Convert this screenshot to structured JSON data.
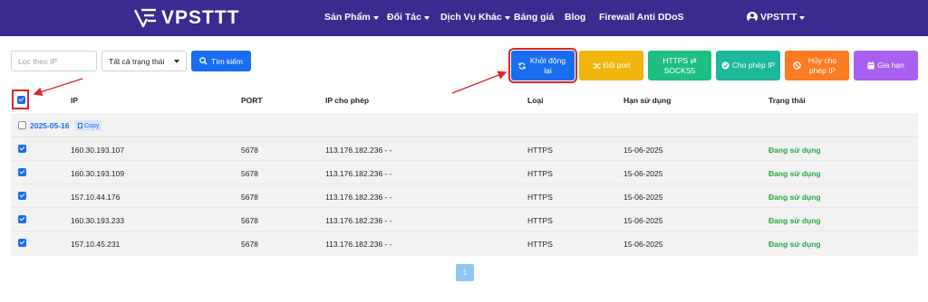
{
  "nav": {
    "logo_text": "VPSTTT",
    "items": [
      {
        "label": "Sản Phẩm",
        "has_caret": true
      },
      {
        "label": "Đối Tác",
        "has_caret": true
      },
      {
        "label": "Dịch Vụ Khác",
        "has_caret": true
      },
      {
        "label": "Bảng giá",
        "has_caret": false
      },
      {
        "label": "Blog",
        "has_caret": false
      },
      {
        "label": "Firewall Anti DDoS",
        "has_caret": false
      }
    ],
    "user": {
      "label": "VPSTTT",
      "icon": "user-circle-icon"
    }
  },
  "filters": {
    "ip_placeholder": "Lọc theo IP",
    "status_selected": "Tất cả trạng thái",
    "search_label": "Tìm kiếm"
  },
  "actions": {
    "restart": "Khởi động lại",
    "change_port": "Đổi port",
    "https_socks": "HTTPS ⇄ SOCKS5",
    "allow_ip": "Cho phép IP",
    "cancel_allow_ip": "Hủy cho phép IP",
    "renew": "Gia hạn"
  },
  "table": {
    "headers": [
      "IP",
      "PORT",
      "IP cho phép",
      "Loại",
      "Hạn sử dụng",
      "Trạng thái"
    ],
    "group": {
      "date": "2025-05-16",
      "copy_label": "Copy"
    },
    "rows": [
      {
        "ip": "160.30.193.107",
        "port": "5678",
        "allowed_ip": "113.176.182.236 - -",
        "type": "HTTPS",
        "expiry": "15-06-2025",
        "status": "Đang sử dụng"
      },
      {
        "ip": "160.30.193.109",
        "port": "5678",
        "allowed_ip": "113.176.182.236 - -",
        "type": "HTTPS",
        "expiry": "15-06-2025",
        "status": "Đang sử dụng"
      },
      {
        "ip": "157.10.44.176",
        "port": "5678",
        "allowed_ip": "113.176.182.236 - -",
        "type": "HTTPS",
        "expiry": "15-06-2025",
        "status": "Đang sử dụng"
      },
      {
        "ip": "160.30.193.233",
        "port": "5678",
        "allowed_ip": "113.176.182.236 - -",
        "type": "HTTPS",
        "expiry": "15-06-2025",
        "status": "Đang sử dụng"
      },
      {
        "ip": "157.10.45.231",
        "port": "5678",
        "allowed_ip": "113.176.182.236 - -",
        "type": "HTTPS",
        "expiry": "15-06-2025",
        "status": "Đang sử dụng"
      }
    ]
  },
  "pagination": {
    "current_page": "1"
  },
  "colors": {
    "nav_bg": "#3b2a8f",
    "primary": "#1a6cf0",
    "status_active": "#28a745",
    "annotation": "#e02424"
  }
}
